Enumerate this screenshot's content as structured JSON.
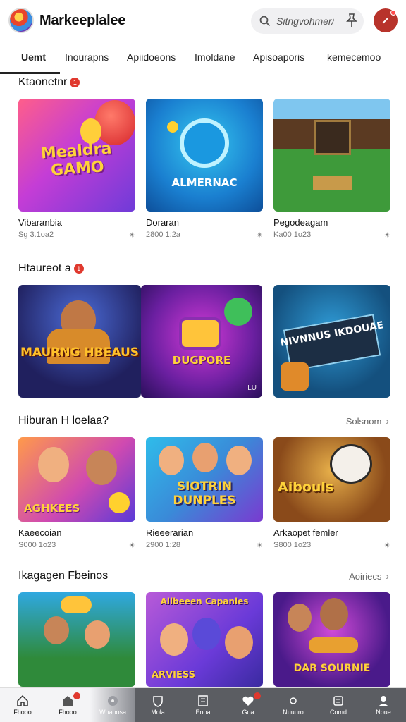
{
  "header": {
    "title": "Markeeplalee",
    "search_placeholder": "Sitngvohmer/"
  },
  "tabs": [
    "Uemt",
    "Inourapns",
    "Apiidoeons",
    "Imoldane",
    "Apisoaporis",
    "kemecemoo"
  ],
  "sections": [
    {
      "title": "Ktaonetnr",
      "badge": "1",
      "see_all": "",
      "cards": [
        {
          "title": "Vibaranbia",
          "meta": "Sg 3.1oa2",
          "rating": "✴"
        },
        {
          "title": "Doraran",
          "meta": "2800 1:2a",
          "rating": "✴"
        },
        {
          "title": "Pegodeagam",
          "meta": "Ka00 1o23",
          "rating": "✴"
        }
      ]
    },
    {
      "title": "Htaureot a",
      "badge": "1",
      "see_all": "",
      "cards": [
        {
          "title": "",
          "meta": "",
          "rating": ""
        },
        {
          "title": "",
          "meta": "",
          "rating": "LU"
        },
        {
          "title": "",
          "meta": "",
          "rating": ""
        }
      ]
    },
    {
      "title": "Hiburan H loelaa?",
      "badge": "",
      "see_all": "Solsnom",
      "cards": [
        {
          "title": "Kaeecoian",
          "meta": "S000 1o23",
          "rating": "✴"
        },
        {
          "title": "Rieeerarian",
          "meta": "2900 1:28",
          "rating": "✴"
        },
        {
          "title": "Arkaopet femler",
          "meta": "S800 1o23",
          "rating": "✴"
        }
      ]
    },
    {
      "title": "Ikagagen Fbeinos",
      "badge": "",
      "see_all": "Aoiriecs",
      "cards": [
        {
          "title": "",
          "meta": "",
          "rating": ""
        },
        {
          "title": "",
          "meta": "",
          "rating": ""
        },
        {
          "title": "",
          "meta": "",
          "rating": ""
        }
      ]
    }
  ],
  "thumbs": {
    "t1": "Mealdra GAMO",
    "t2": "ALMERNAC",
    "t4": "MAURNG HBEAUS",
    "t5": "DUGPORE",
    "t6": "NIVNNUS IKDOUAE",
    "t7": "AGHKEES",
    "t8": "SIOTRIN DUNPLES",
    "t9": "Aibouls",
    "t11": "Allbeeen Capanles",
    "t10": "ARVIESS",
    "t12": "DAR SOURNIE"
  },
  "bottom_nav": [
    {
      "label": "Fhooo",
      "icon": "home-icon"
    },
    {
      "label": "Fhooo",
      "icon": "store-icon"
    },
    {
      "label": "Whaoosa",
      "icon": "disc-icon"
    },
    {
      "label": "Mola",
      "icon": "shield-icon"
    },
    {
      "label": "Enoa",
      "icon": "book-icon"
    },
    {
      "label": "Goa",
      "icon": "heart-icon"
    },
    {
      "label": "Nuuuro",
      "icon": "circle-icon"
    },
    {
      "label": "Comd",
      "icon": "document-icon"
    },
    {
      "label": "Noue",
      "icon": "person-icon"
    }
  ]
}
